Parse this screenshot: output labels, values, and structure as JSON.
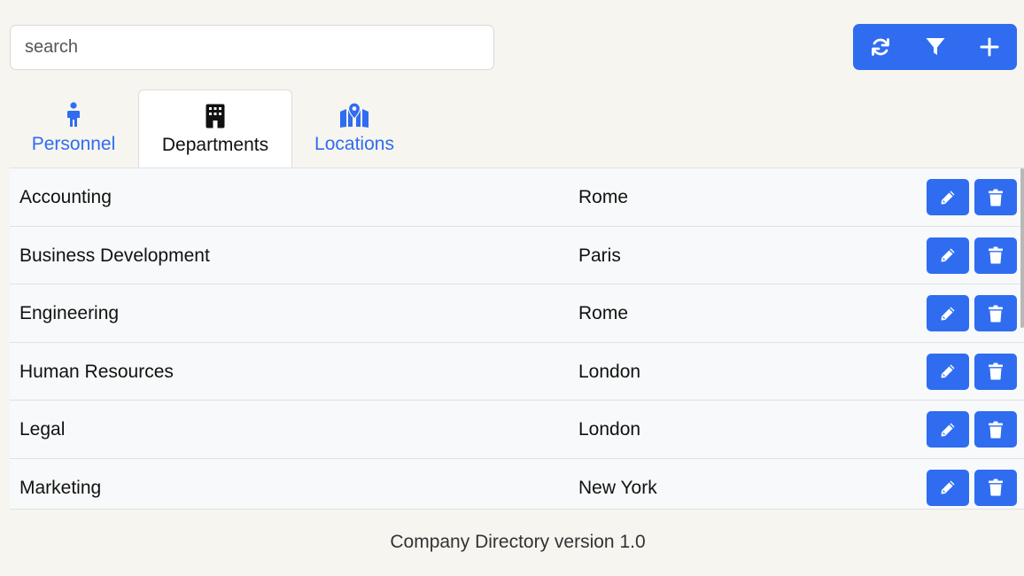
{
  "search": {
    "placeholder": "search",
    "value": ""
  },
  "toolbar": {
    "buttons": [
      {
        "icon": "refresh-icon"
      },
      {
        "icon": "filter-icon"
      },
      {
        "icon": "plus-icon"
      }
    ]
  },
  "tabs": [
    {
      "label": "Personnel",
      "icon": "person-icon",
      "active": false
    },
    {
      "label": "Departments",
      "icon": "building-icon",
      "active": true
    },
    {
      "label": "Locations",
      "icon": "map-location-icon",
      "active": false
    }
  ],
  "departments": [
    {
      "name": "Accounting",
      "location": "Rome"
    },
    {
      "name": "Business Development",
      "location": "Paris"
    },
    {
      "name": "Engineering",
      "location": "Rome"
    },
    {
      "name": "Human Resources",
      "location": "London"
    },
    {
      "name": "Legal",
      "location": "London"
    },
    {
      "name": "Marketing",
      "location": "New York"
    }
  ],
  "footer": {
    "text": "Company Directory version 1.0"
  },
  "colors": {
    "accent": "#2f6cf0",
    "background": "#f7f5f0",
    "row": "#f8f9fa"
  }
}
